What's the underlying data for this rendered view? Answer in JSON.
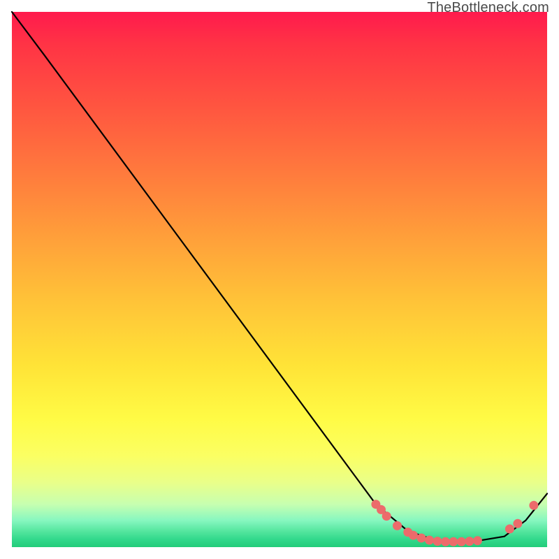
{
  "watermark": "TheBottleneck.com",
  "chart_data": {
    "type": "line",
    "title": "",
    "xlabel": "",
    "ylabel": "",
    "xlim": [
      0,
      1
    ],
    "ylim": [
      0,
      1
    ],
    "series": [
      {
        "name": "curve",
        "x": [
          0.0,
          0.06,
          0.68,
          0.74,
          0.8,
          0.86,
          0.92,
          0.96,
          1.0
        ],
        "y": [
          1.0,
          0.92,
          0.08,
          0.03,
          0.01,
          0.01,
          0.02,
          0.05,
          0.1
        ]
      }
    ],
    "markers": {
      "name": "highlight-points",
      "color": "#ec6b6b",
      "x": [
        0.68,
        0.69,
        0.7,
        0.72,
        0.74,
        0.75,
        0.765,
        0.78,
        0.795,
        0.81,
        0.825,
        0.84,
        0.855,
        0.87,
        0.93,
        0.945,
        0.975
      ],
      "y": [
        0.08,
        0.07,
        0.058,
        0.04,
        0.028,
        0.022,
        0.017,
        0.013,
        0.011,
        0.01,
        0.01,
        0.01,
        0.011,
        0.012,
        0.034,
        0.044,
        0.078
      ]
    },
    "background_gradient": {
      "direction": "vertical",
      "stops": [
        {
          "pos": 0.0,
          "color": "#ff1a4d"
        },
        {
          "pos": 0.18,
          "color": "#ff5640"
        },
        {
          "pos": 0.42,
          "color": "#ff9f3a"
        },
        {
          "pos": 0.66,
          "color": "#ffe337"
        },
        {
          "pos": 0.83,
          "color": "#fbff63"
        },
        {
          "pos": 0.95,
          "color": "#87f7c0"
        },
        {
          "pos": 1.0,
          "color": "#23cc7a"
        }
      ]
    }
  }
}
